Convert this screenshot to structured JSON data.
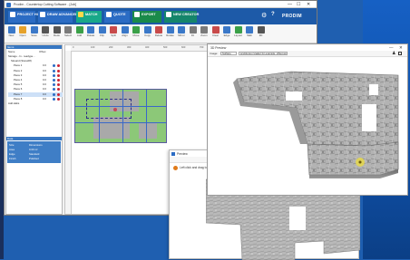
{
  "window": {
    "title": "Prodim - Countertop Cutting Software - [Job]",
    "controls": [
      "—",
      "☐",
      "✕"
    ]
  },
  "nav": {
    "tabs": [
      {
        "label": "PROJECT HOME",
        "color": "#2b6cc4"
      },
      {
        "label": "DRAW ADVANCED",
        "color": "#2b6cc4"
      },
      {
        "label": "MATCH",
        "color": "#18a889"
      },
      {
        "label": "QUOTE",
        "color": "#2b6cc4"
      },
      {
        "label": "EXPORT",
        "color": "#1a8a4a"
      },
      {
        "label": "NEW CREATOR",
        "color": "#15856b"
      }
    ],
    "brand": "PRODIM",
    "right_icons": [
      "gear-icon",
      "help-icon"
    ]
  },
  "ribbon": {
    "buttons": [
      "New",
      "Open",
      "Save",
      "Undo",
      "Redo",
      "Select",
      "Add",
      "Rotate",
      "Flip",
      "Split",
      "Align",
      "Move",
      "Copy",
      "Delete",
      "Rotate",
      "Mirror",
      "Fit",
      "Zoom",
      "Clear",
      "Edge",
      "Layout",
      "Slab",
      "3D"
    ]
  },
  "left_panel": {
    "header": "Items",
    "columns": [
      "Name",
      "Offset"
    ],
    "tree": [
      {
        "label": "Storage - In - readype...",
        "value": ""
      },
      {
        "label": "Slooard (Stone08)",
        "value": ""
      },
      {
        "label": "Piece 1",
        "value": "0.0"
      },
      {
        "label": "Piece 2",
        "value": "0.0"
      },
      {
        "label": "Piece 3",
        "value": "0.0"
      },
      {
        "label": "Piece 4",
        "value": "0.0"
      },
      {
        "label": "Piece 5",
        "value": "0.0"
      },
      {
        "label": "Piece 6",
        "value": "0.0"
      },
      {
        "label": "Piece 7",
        "value": "0.0"
      },
      {
        "label": "Piece 8",
        "value": "0.0"
      },
      {
        "label": "Add slabs",
        "value": ""
      }
    ],
    "selected_index": 8,
    "properties_header": "Data",
    "properties": [
      {
        "k": "Size",
        "v": "Dimensions"
      },
      {
        "k": "Area",
        "v": "0.00 m²"
      },
      {
        "k": "Edge",
        "v": "Standard"
      },
      {
        "k": "Finish",
        "v": "Polished"
      }
    ]
  },
  "canvas": {
    "ruler_ticks": [
      "0",
      "100",
      "200",
      "300",
      "400",
      "500",
      "600",
      "700"
    ]
  },
  "preview": {
    "title": "3D Preview",
    "toolbar": {
      "image_label": "Image:",
      "image_value": "Surface",
      "texture_value": "sculptures (snake) for example_offset.work"
    },
    "controls": [
      "—",
      "✕"
    ]
  },
  "dialog": {
    "title": "Preview",
    "message": "Left click and drag to rotate view"
  }
}
